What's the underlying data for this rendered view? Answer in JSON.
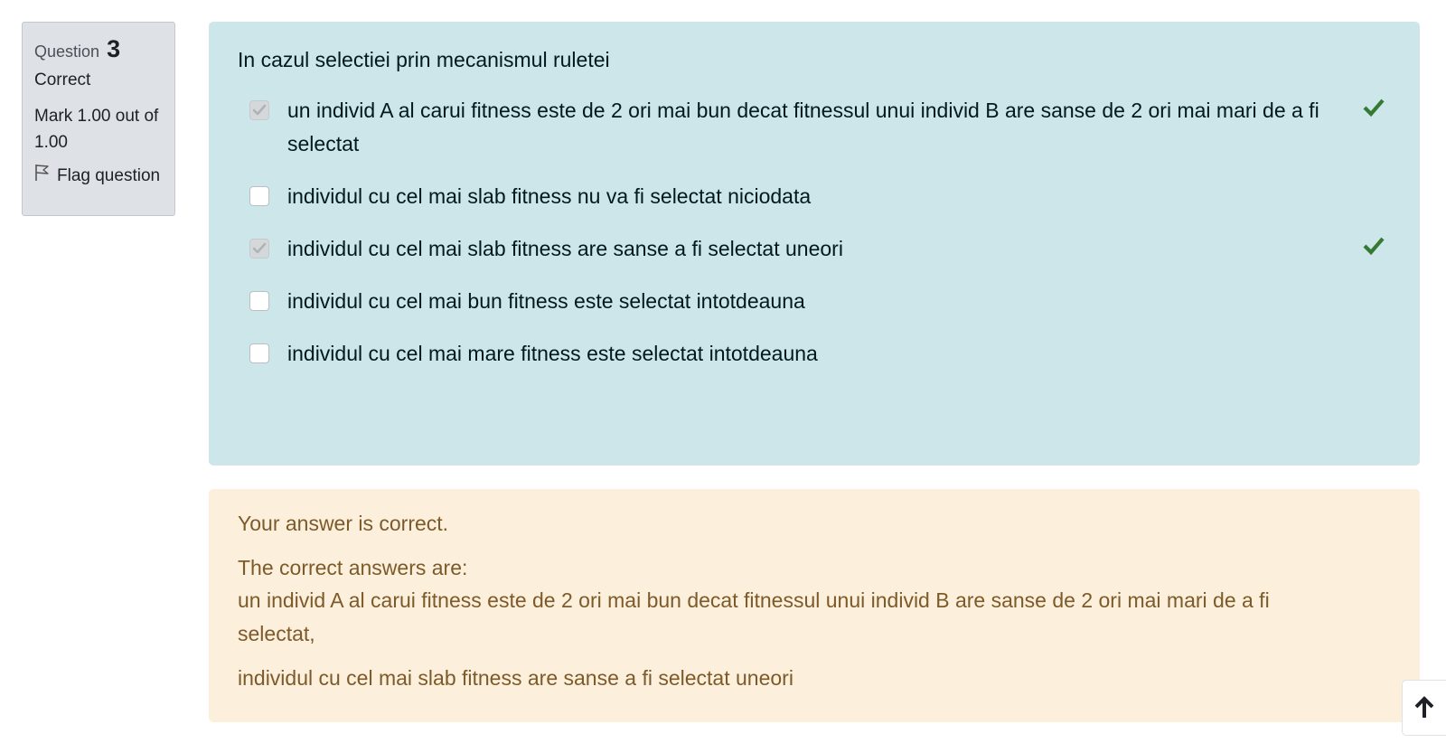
{
  "info": {
    "question_label": "Question",
    "question_number": "3",
    "state": "Correct",
    "grade": "Mark 1.00 out of 1.00",
    "flag_label": "Flag question"
  },
  "question": {
    "text": "In cazul selectiei prin mecanismul ruletei",
    "options": [
      {
        "label": "un individ A al carui fitness este de 2 ori mai bun decat fitnessul unui individ B are sanse de 2 ori mai mari de a fi selectat",
        "checked": true,
        "correct": true
      },
      {
        "label": "individul cu cel mai slab fitness nu va fi selectat niciodata",
        "checked": false,
        "correct": false
      },
      {
        "label": "individul cu cel mai slab fitness are sanse a fi selectat uneori",
        "checked": true,
        "correct": true
      },
      {
        "label": "individul cu cel mai bun fitness este selectat intotdeauna",
        "checked": false,
        "correct": false
      },
      {
        "label": "individul cu cel mai mare fitness este selectat intotdeauna",
        "checked": false,
        "correct": false
      }
    ]
  },
  "feedback": {
    "result": "Your answer is correct.",
    "right_answer_title": "The correct answers are:",
    "right_answers": [
      "un individ A al carui fitness este de 2 ori mai bun decat fitnessul unui individ B are sanse de 2 ori mai mari de a fi selectat,",
      "individul cu cel mai slab fitness are sanse a fi selectat uneori"
    ]
  },
  "colors": {
    "formulation_bg": "#cce6ea",
    "feedback_bg": "#fcefdc",
    "info_bg": "#dee2e6",
    "correct_tick": "#357a32"
  },
  "icons": {
    "flag": "flag-outline-icon",
    "correct": "check-icon",
    "back_to_top": "arrow-up-icon"
  }
}
